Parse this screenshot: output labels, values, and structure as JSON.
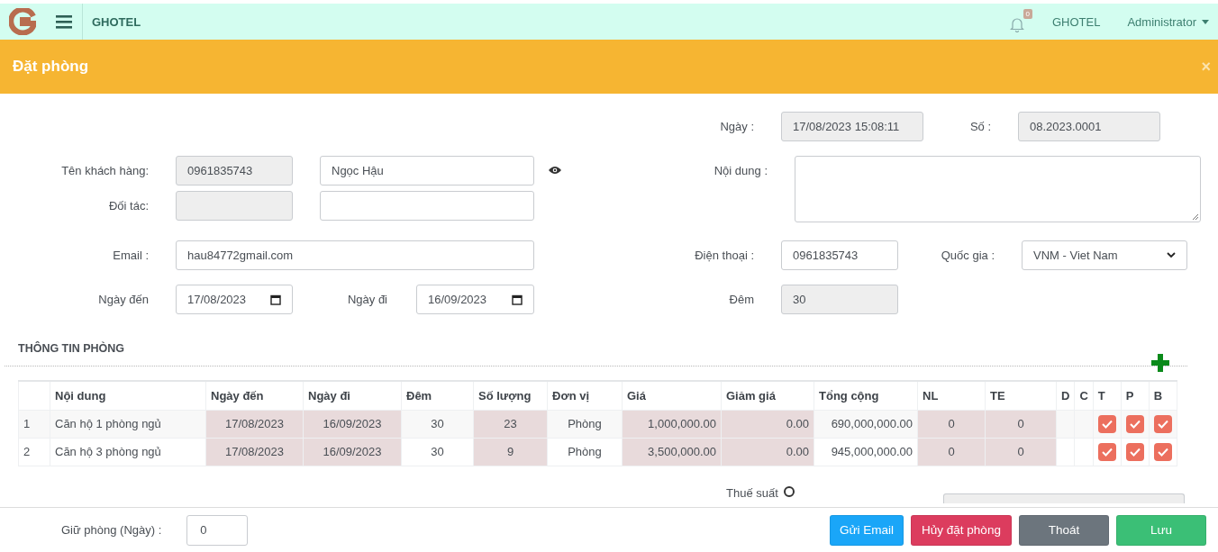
{
  "navbar": {
    "brand": "GHOTEL",
    "notification_count": "0",
    "site": "GHOTEL",
    "user": "Administrator"
  },
  "dialog": {
    "title": "Đặt phòng",
    "close": "×"
  },
  "form": {
    "date": {
      "label": "Ngày :",
      "value": "17/08/2023 15:08:11"
    },
    "number": {
      "label": "Số :",
      "value": "08.2023.0001"
    },
    "customer": {
      "label": "Tên khách hàng:",
      "code": "0961835743",
      "name": "Ngọc Hậu"
    },
    "partner": {
      "label": "Đối tác:"
    },
    "content": {
      "label": "Nội dung :"
    },
    "email": {
      "label": "Email :",
      "value": "hau84772gmail.com"
    },
    "phone": {
      "label": "Điện thoại :",
      "value": "0961835743"
    },
    "country": {
      "label": "Quốc gia :",
      "value": "VNM - Viet Nam"
    },
    "arrival": {
      "label": "Ngày đến",
      "value": "17/08/2023"
    },
    "departure": {
      "label": "Ngày đi",
      "value": "16/09/2023"
    },
    "nights": {
      "label": "Đêm",
      "value": "30"
    }
  },
  "rooms": {
    "title": "THÔNG TIN PHÒNG",
    "columns": [
      {
        "kind": "index"
      },
      {
        "label": "Nội dung",
        "kind": "text",
        "editable": false
      },
      {
        "label": "Ngày đến",
        "kind": "center",
        "editable": true
      },
      {
        "label": "Ngày đi",
        "kind": "center",
        "editable": true
      },
      {
        "label": "Đêm",
        "kind": "center",
        "editable": false
      },
      {
        "label": "Số lượng",
        "kind": "center",
        "editable": true
      },
      {
        "label": "Đơn vị",
        "kind": "center",
        "editable": false
      },
      {
        "label": "Giá",
        "kind": "money",
        "editable": true
      },
      {
        "label": "Giảm giá",
        "kind": "money",
        "editable": true
      },
      {
        "label": "Tổng cộng",
        "kind": "money",
        "editable": false
      },
      {
        "label": "NL",
        "kind": "center",
        "editable": true
      },
      {
        "label": "TE",
        "kind": "center",
        "editable": true
      },
      {
        "label": "D",
        "kind": "flag"
      },
      {
        "label": "C",
        "kind": "flag"
      },
      {
        "label": "T",
        "kind": "check"
      },
      {
        "label": "P",
        "kind": "check"
      },
      {
        "label": "B",
        "kind": "check"
      }
    ],
    "rows": [
      {
        "cells": [
          "1",
          "Căn hộ 1 phòng ngủ",
          "17/08/2023",
          "16/09/2023",
          "30",
          "23",
          "Phòng",
          "1,000,000.00",
          "0.00",
          "690,000,000.00",
          "0",
          "0"
        ],
        "checks": [
          {
            "checked": true
          },
          {
            "checked": true
          },
          {
            "checked": true
          }
        ]
      },
      {
        "cells": [
          "2",
          "Căn hộ 3 phòng ngủ",
          "17/08/2023",
          "16/09/2023",
          "30",
          "9",
          "Phòng",
          "3,500,000.00",
          "0.00",
          "945,000,000.00",
          "0",
          "0"
        ],
        "checks": [
          {
            "checked": true
          },
          {
            "checked": true
          },
          {
            "checked": true
          }
        ]
      }
    ]
  },
  "tax": {
    "label": "Thuế suất"
  },
  "footer": {
    "hold_label": "Giữ phòng (Ngày) :",
    "hold_value": "0",
    "buttons": [
      {
        "label": "Gửi Email",
        "kind": "info"
      },
      {
        "label": "Hủy đặt phòng",
        "kind": "danger"
      },
      {
        "label": "Thoát",
        "kind": "secondary"
      },
      {
        "label": "Lưu",
        "kind": "success"
      }
    ]
  }
}
